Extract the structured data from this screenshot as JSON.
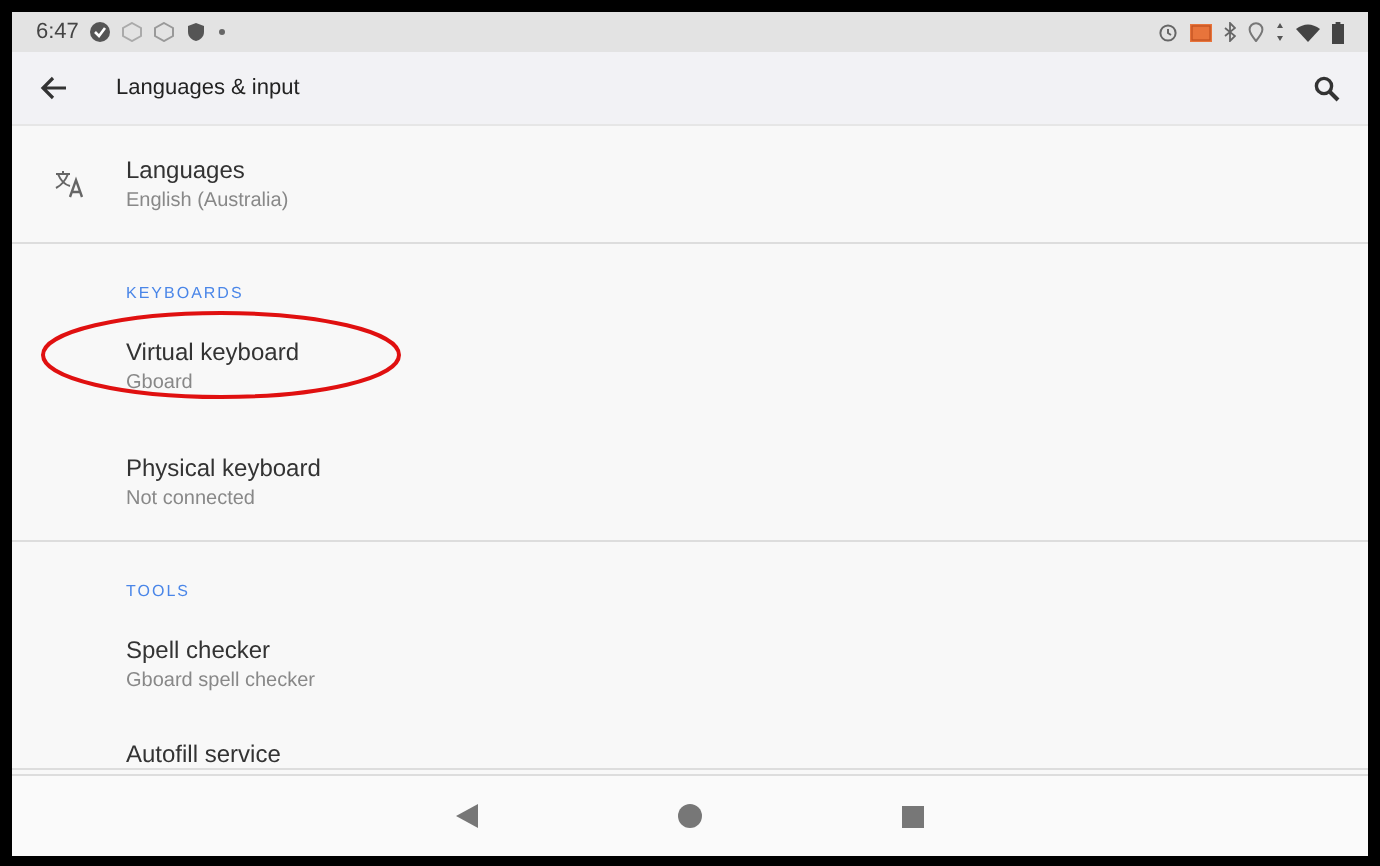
{
  "status_bar": {
    "time": "6:47"
  },
  "toolbar": {
    "title": "Languages & input"
  },
  "sections": [
    {
      "items": [
        {
          "kind": "icon",
          "title": "Languages",
          "summary": "English (Australia)",
          "highlighted": false
        }
      ]
    },
    {
      "header": "KEYBOARDS",
      "items": [
        {
          "kind": "plain",
          "title": "Virtual keyboard",
          "summary": "Gboard",
          "highlighted": true
        },
        {
          "kind": "plain",
          "title": "Physical keyboard",
          "summary": "Not connected",
          "highlighted": false
        }
      ]
    },
    {
      "header": "TOOLS",
      "items": [
        {
          "kind": "plain",
          "title": "Spell checker",
          "summary": "Gboard spell checker",
          "highlighted": false
        },
        {
          "kind": "partial",
          "title": "Autofill service",
          "highlighted": false
        }
      ]
    }
  ]
}
